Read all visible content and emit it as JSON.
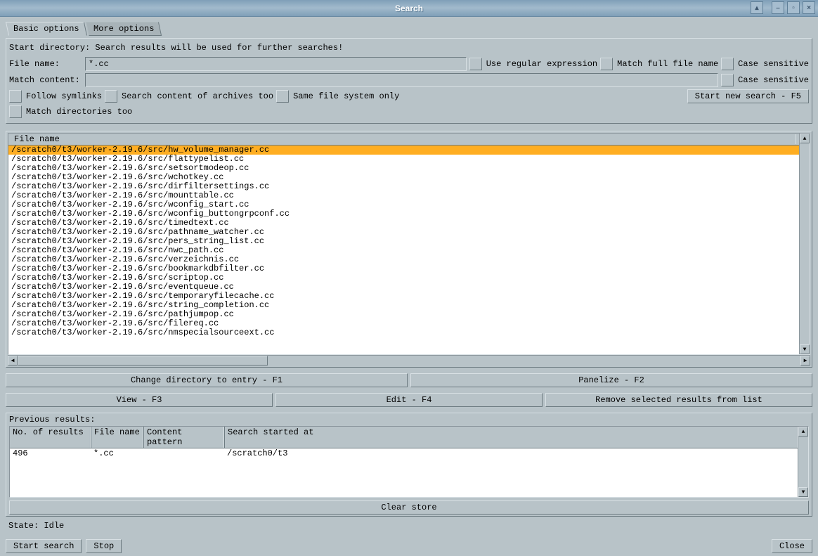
{
  "window": {
    "title": "Search"
  },
  "tabs": {
    "basic": "Basic options",
    "more": "More options"
  },
  "form": {
    "start_dir_label": "Start directory: Search results will be used for further searches!",
    "filename_label": "File name:",
    "filename_value": "*.cc",
    "match_content_label": "Match content:",
    "match_content_value": "",
    "regex_label": "Use regular expression",
    "fullname_label": "Match full file name",
    "case_name_label": "Case sensitive",
    "case_content_label": "Case sensitive",
    "follow_symlinks_label": "Follow symlinks",
    "archives_label": "Search content of archives too",
    "same_fs_label": "Same file system only",
    "match_dirs_label": "Match directories too",
    "start_search_btn": "Start new search - F5"
  },
  "results": {
    "header": "File name",
    "rows": [
      "/scratch0/t3/worker-2.19.6/src/hw_volume_manager.cc",
      "/scratch0/t3/worker-2.19.6/src/flattypelist.cc",
      "/scratch0/t3/worker-2.19.6/src/setsortmodeop.cc",
      "/scratch0/t3/worker-2.19.6/src/wchotkey.cc",
      "/scratch0/t3/worker-2.19.6/src/dirfiltersettings.cc",
      "/scratch0/t3/worker-2.19.6/src/mounttable.cc",
      "/scratch0/t3/worker-2.19.6/src/wconfig_start.cc",
      "/scratch0/t3/worker-2.19.6/src/wconfig_buttongrpconf.cc",
      "/scratch0/t3/worker-2.19.6/src/timedtext.cc",
      "/scratch0/t3/worker-2.19.6/src/pathname_watcher.cc",
      "/scratch0/t3/worker-2.19.6/src/pers_string_list.cc",
      "/scratch0/t3/worker-2.19.6/src/nwc_path.cc",
      "/scratch0/t3/worker-2.19.6/src/verzeichnis.cc",
      "/scratch0/t3/worker-2.19.6/src/bookmarkdbfilter.cc",
      "/scratch0/t3/worker-2.19.6/src/scriptop.cc",
      "/scratch0/t3/worker-2.19.6/src/eventqueue.cc",
      "/scratch0/t3/worker-2.19.6/src/temporaryfilecache.cc",
      "/scratch0/t3/worker-2.19.6/src/string_completion.cc",
      "/scratch0/t3/worker-2.19.6/src/pathjumpop.cc",
      "/scratch0/t3/worker-2.19.6/src/filereq.cc",
      "/scratch0/t3/worker-2.19.6/src/nmspecialsourceext.cc"
    ]
  },
  "actions": {
    "change_dir": "Change directory to entry - F1",
    "panelize": "Panelize - F2",
    "view": "View - F3",
    "edit": "Edit - F4",
    "remove": "Remove selected results from list"
  },
  "prev": {
    "title": "Previous results:",
    "headers": {
      "count": "No. of results",
      "filename": "File name",
      "pattern": "Content pattern",
      "started": "Search started at"
    },
    "row": {
      "count": "496",
      "filename": "*.cc",
      "pattern": "",
      "started": "/scratch0/t3"
    },
    "clear_btn": "Clear store"
  },
  "status": {
    "label": "State:",
    "value": "Idle"
  },
  "bottom": {
    "start": "Start search",
    "stop": "Stop",
    "close": "Close"
  }
}
